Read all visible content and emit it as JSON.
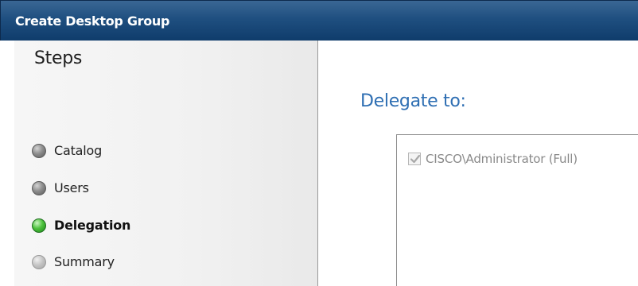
{
  "window": {
    "title": "Create Desktop Group"
  },
  "sidebar": {
    "heading": "Steps",
    "steps": [
      {
        "label": "Catalog",
        "state": "done",
        "icon": "grey-circle-icon"
      },
      {
        "label": "Users",
        "state": "done",
        "icon": "grey-circle-icon"
      },
      {
        "label": "Delegation",
        "state": "current",
        "icon": "green-circle-icon"
      },
      {
        "label": "Summary",
        "state": "pending",
        "icon": "light-grey-circle-icon"
      }
    ]
  },
  "main": {
    "heading": "Delegate to:",
    "delegates": [
      {
        "label": "CISCO\\Administrator (Full)",
        "checked": true,
        "disabled": true
      }
    ]
  },
  "colors": {
    "titlebar": "#1f4f80",
    "heading_accent": "#2f6fb3",
    "current_step": "#4ec23e"
  }
}
